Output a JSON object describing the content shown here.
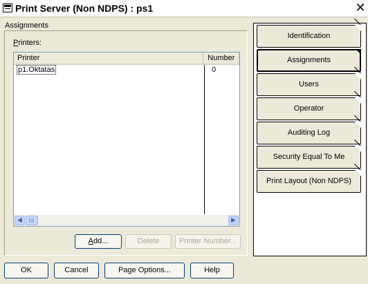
{
  "window": {
    "title": "Print Server (Non NDPS) : ps1",
    "close_symbol": "✕"
  },
  "section": {
    "label": "Assignments"
  },
  "printers": {
    "label_prefix": "P",
    "label_rest": "rinters:",
    "columns": [
      "Printer",
      "Number"
    ],
    "rows": [
      {
        "printer": "p1.Oktatas",
        "number": "0"
      }
    ]
  },
  "scrollbar": {
    "left_arrow": "◀",
    "right_arrow": "▶"
  },
  "panel_buttons": {
    "add_underlined": "A",
    "add_rest": "dd...",
    "delete": "Delete",
    "printer_number": "Printer Number..."
  },
  "tabs": [
    {
      "label": "Identification",
      "active": false
    },
    {
      "label": "Assignments",
      "active": true
    },
    {
      "label": "Users",
      "active": false
    },
    {
      "label": "Operator",
      "active": false
    },
    {
      "label": "Auditing Log",
      "active": false
    },
    {
      "label": "Security Equal To Me",
      "active": false
    },
    {
      "label": "Print Layout (Non NDPS)",
      "active": false
    }
  ],
  "bottom_buttons": {
    "ok": "OK",
    "cancel": "Cancel",
    "page_options": "Page Options...",
    "help": "Help"
  }
}
